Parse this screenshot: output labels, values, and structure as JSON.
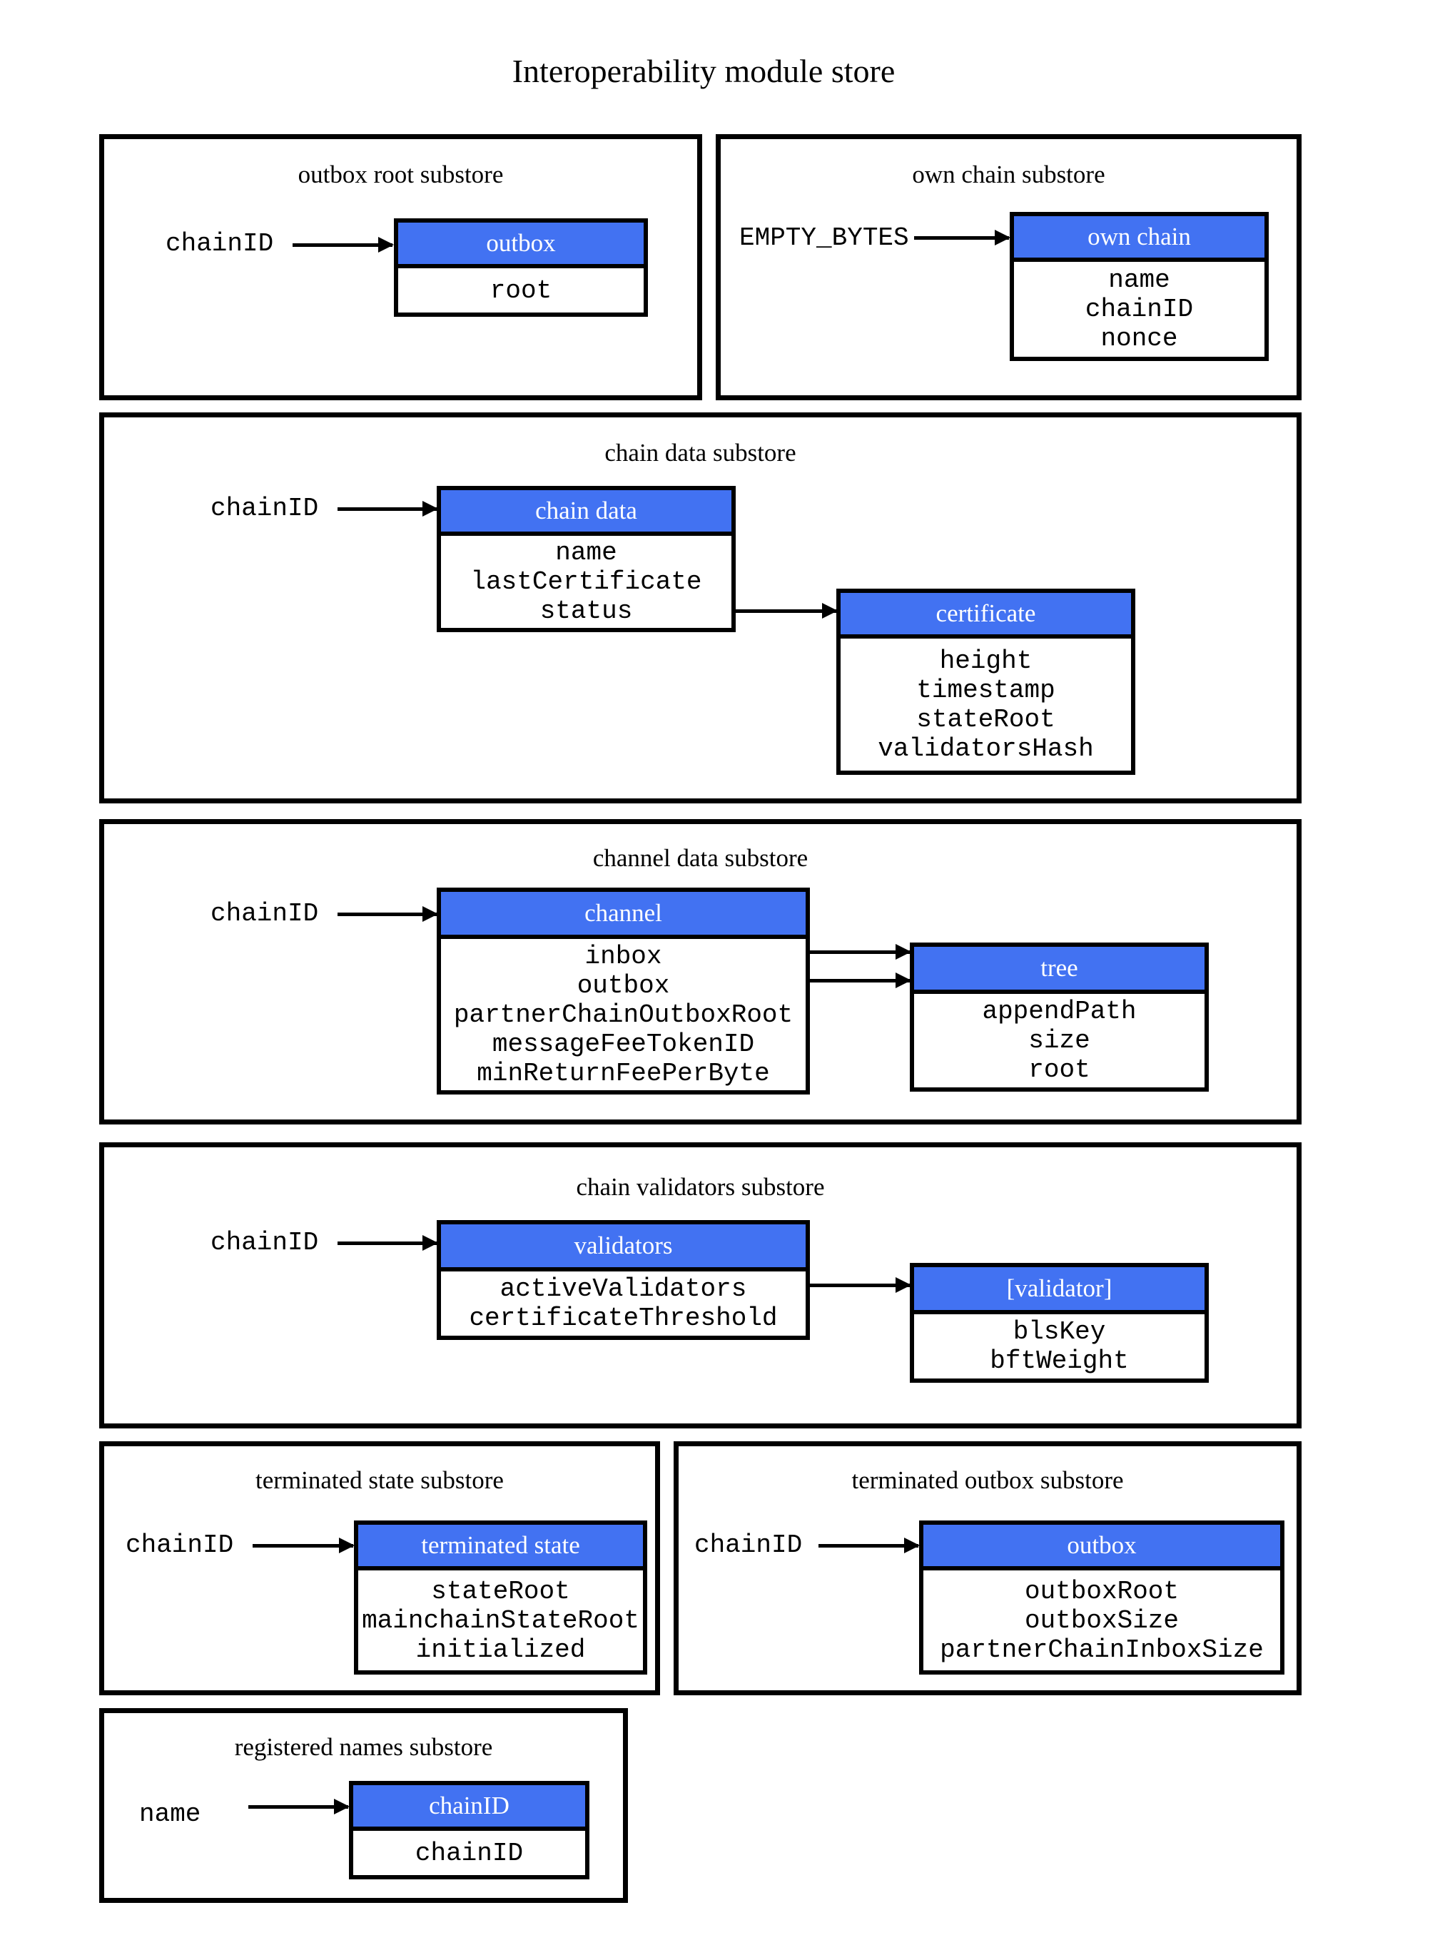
{
  "title": "Interoperability module store",
  "colors": {
    "record_header": "#4272F2",
    "stroke": "#000000",
    "header_text": "#FFFFFF"
  },
  "substores": {
    "outbox_root": {
      "title": "outbox root substore",
      "key": "chainID",
      "record": {
        "header": "outbox",
        "fields": [
          "root"
        ]
      }
    },
    "own_chain": {
      "title": "own chain substore",
      "key": "EMPTY_BYTES",
      "record": {
        "header": "own chain",
        "fields": [
          "name",
          "chainID",
          "nonce"
        ]
      }
    },
    "chain_data": {
      "title": "chain data substore",
      "key": "chainID",
      "record": {
        "header": "chain data",
        "fields": [
          "name",
          "lastCertificate",
          "status"
        ]
      },
      "sub_record": {
        "header": "certificate",
        "fields": [
          "height",
          "timestamp",
          "stateRoot",
          "validatorsHash"
        ]
      }
    },
    "channel_data": {
      "title": "channel data substore",
      "key": "chainID",
      "record": {
        "header": "channel",
        "fields": [
          "inbox",
          "outbox",
          "partnerChainOutboxRoot",
          "messageFeeTokenID",
          "minReturnFeePerByte"
        ]
      },
      "sub_record": {
        "header": "tree",
        "fields": [
          "appendPath",
          "size",
          "root"
        ]
      }
    },
    "chain_validators": {
      "title": "chain validators substore",
      "key": "chainID",
      "record": {
        "header": "validators",
        "fields": [
          "activeValidators",
          "certificateThreshold"
        ]
      },
      "sub_record": {
        "header": "[validator]",
        "fields": [
          "blsKey",
          "bftWeight"
        ]
      }
    },
    "terminated_state": {
      "title": "terminated state substore",
      "key": "chainID",
      "record": {
        "header": "terminated state",
        "fields": [
          "stateRoot",
          "mainchainStateRoot",
          "initialized"
        ]
      }
    },
    "terminated_outbox": {
      "title": "terminated outbox substore",
      "key": "chainID",
      "record": {
        "header": "outbox",
        "fields": [
          "outboxRoot",
          "outboxSize",
          "partnerChainInboxSize"
        ]
      }
    },
    "registered_names": {
      "title": "registered names substore",
      "key": "name",
      "record": {
        "header": "chainID",
        "fields": [
          "chainID"
        ]
      }
    }
  }
}
